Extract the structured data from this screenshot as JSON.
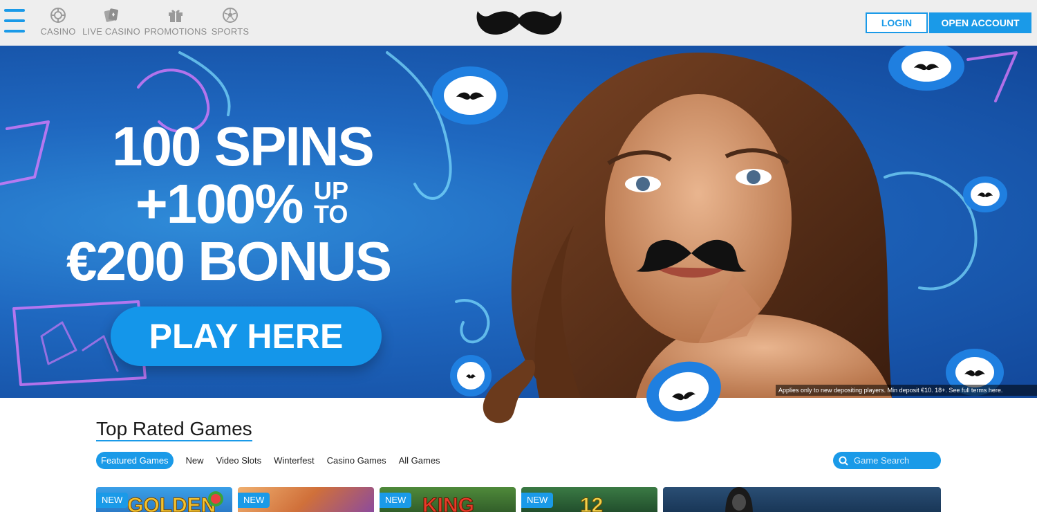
{
  "header": {
    "nav": [
      {
        "label": "CASINO",
        "icon": "roulette-wheel-icon"
      },
      {
        "label": "LIVE CASINO",
        "icon": "playing-cards-icon"
      },
      {
        "label": "PROMOTIONS",
        "icon": "gift-box-icon"
      },
      {
        "label": "SPORTS",
        "icon": "soccer-ball-icon"
      }
    ],
    "logo": "mustache-logo",
    "login_label": "LOGIN",
    "open_account_label": "OPEN ACCOUNT"
  },
  "hero": {
    "line1": "100 SPINS",
    "line2": "+100%",
    "line2_small_top": "UP",
    "line2_small_bottom": "TO",
    "line3": "€200 BONUS",
    "cta_label": "PLAY HERE",
    "terms": "Applies only to new depositing players. Min deposit €10. 18+. See full terms here."
  },
  "games": {
    "title": "Top Rated Games",
    "tabs": [
      "Featured Games",
      "New",
      "Video Slots",
      "Winterfest",
      "Casino Games",
      "All Games"
    ],
    "active_tab": "Featured Games",
    "search_placeholder": "Game Search",
    "tiles": [
      {
        "badge": "NEW",
        "title": "GOLDEN"
      },
      {
        "badge": "NEW",
        "title": ""
      },
      {
        "badge": "NEW",
        "title": "KING"
      },
      {
        "badge": "NEW",
        "title": "12"
      },
      {
        "badge": "",
        "title": ""
      }
    ]
  },
  "colors": {
    "accent": "#1a9ae8",
    "header_bg": "#eeeeee",
    "hero_blue": "#1f68c0"
  }
}
